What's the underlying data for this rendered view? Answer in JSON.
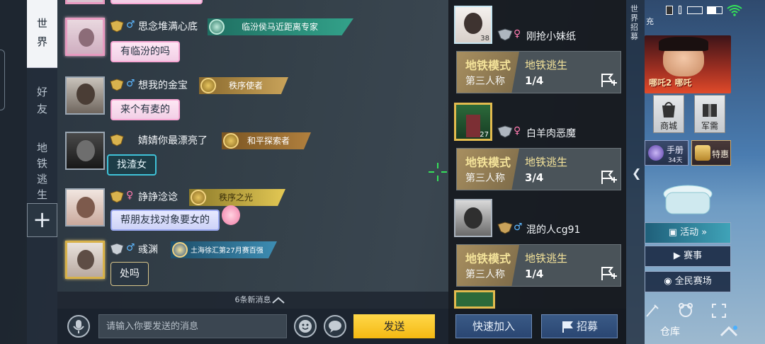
{
  "tabs": {
    "world": "世界",
    "friends": "好友",
    "metro": "地铁逃生",
    "plus": "+"
  },
  "chat": {
    "messages": [
      {
        "name": "思念堆满心底",
        "gender": "♂",
        "gender_class": "m",
        "badge": "临汾侯马近距离专家",
        "badge_color": "#2f8f7a",
        "text": "有临汾的吗",
        "bubble": "pink"
      },
      {
        "name": "想我的金宝",
        "gender": "♂",
        "gender_class": "m",
        "badge": "秩序使者",
        "badge_color": "#a8833a",
        "text": "来个有麦的",
        "bubble": "pink"
      },
      {
        "name": "婧婧你最漂亮了",
        "gender": "",
        "gender_class": "m",
        "badge": "和平探索者",
        "badge_color": "#8a6328",
        "text": "找渣女",
        "bubble": "teal"
      },
      {
        "name": "諍諍淰谂",
        "gender": "♀",
        "gender_class": "f",
        "badge": "秩序之光",
        "badge_color": "#b79a36",
        "text": "帮朋友找对象要女的",
        "bubble": "lav"
      },
      {
        "name": "彧渊",
        "gender": "♂",
        "gender_class": "m",
        "badge": "土海徐汇第27月赛百强",
        "badge_color": "#2e6c8c",
        "text": "处吗",
        "bubble": "dark"
      }
    ],
    "new_messages": "6条新消息",
    "input_placeholder": "请输入你要发送的消息",
    "send": "发送"
  },
  "recruit": {
    "teams": [
      {
        "name": "刚抢小妹纸",
        "gender": "♀",
        "gender_class": "f",
        "level": "38",
        "mode": "地铁模式",
        "view": "第三人称",
        "map": "地铁逃生",
        "count": "1/4"
      },
      {
        "name": "白羊肉恶魔",
        "gender": "♀",
        "gender_class": "f",
        "level": "27",
        "mode": "地铁模式",
        "view": "第三人称",
        "map": "地铁逃生",
        "count": "3/4"
      },
      {
        "name": "混的人cg91",
        "gender": "♂",
        "gender_class": "m",
        "level": "",
        "mode": "地铁模式",
        "view": "第三人称",
        "map": "地铁逃生",
        "count": "1/4"
      }
    ],
    "quick_join": "快速加入",
    "recruit": "招募"
  },
  "right": {
    "world_recruit": "世界招募",
    "status_text": "充",
    "banner_title": "哪吒2 哪吒",
    "shop": "商城",
    "supply": "军需",
    "manual": "手册",
    "manual_days": "34天",
    "special": "特惠",
    "activity": "活动",
    "events": "赛事",
    "arena": "全民赛场",
    "depot": "仓库"
  }
}
